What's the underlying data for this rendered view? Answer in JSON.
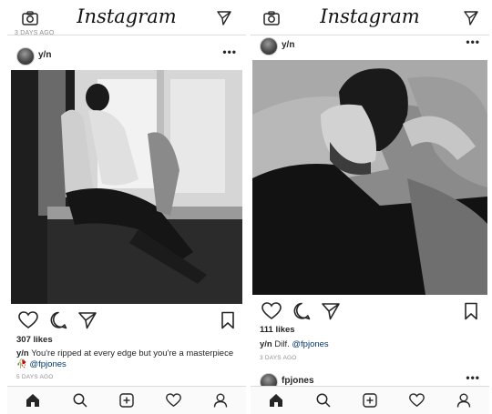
{
  "app": {
    "logo": "Instagram"
  },
  "left": {
    "top_age": "3 DAYS AGO",
    "post": {
      "username": "y/n",
      "more": "•••",
      "likes": "307 likes",
      "caption_user": "y/n",
      "caption_text": "You're ripped at every edge but you're a masterpiece",
      "caption_emoji": "🥀",
      "caption_mention": "@fpjones",
      "age": "5 DAYS AGO"
    }
  },
  "right": {
    "post": {
      "username": "y/n",
      "more": "•••",
      "likes": "111 likes",
      "caption_user": "y/n",
      "caption_text": "Dilf.",
      "caption_mention": "@fpjones",
      "age": "3 DAYS AGO"
    },
    "next_post": {
      "username": "fpjones",
      "more": "•••"
    }
  },
  "icons": {
    "camera": "camera-icon",
    "direct": "paper-plane-icon",
    "like": "heart-icon",
    "comment": "comment-icon",
    "share": "paper-plane-icon",
    "save": "bookmark-icon",
    "home": "home-icon",
    "search": "search-icon",
    "new_post": "plus-square-icon",
    "activity": "heart-icon",
    "profile": "profile-icon"
  }
}
